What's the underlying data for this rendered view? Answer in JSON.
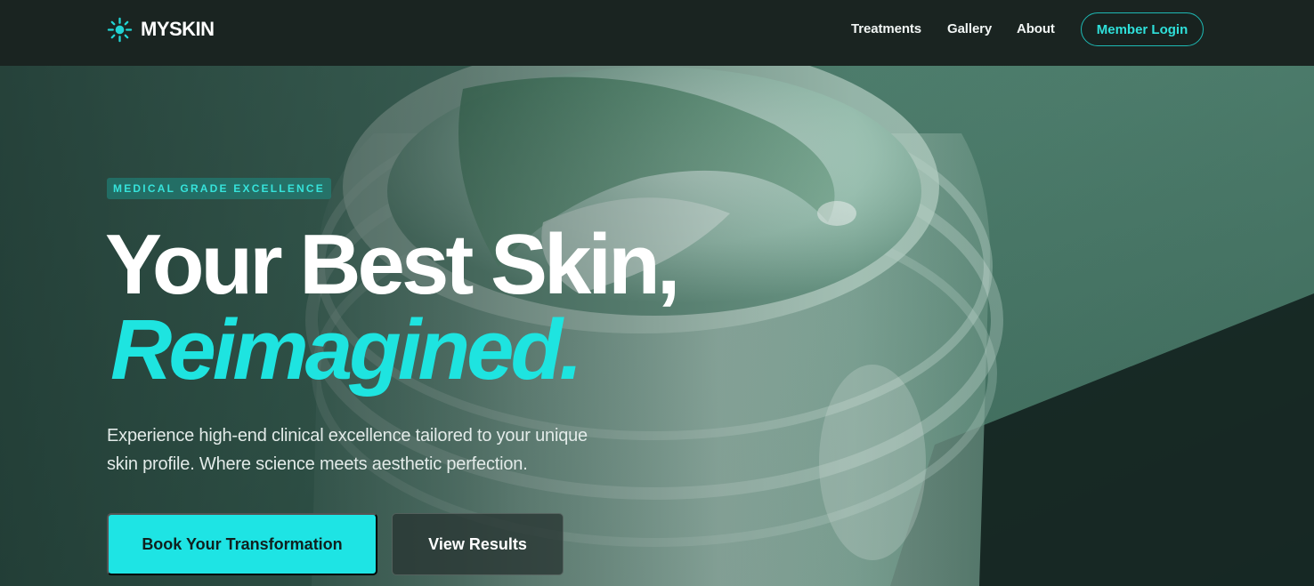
{
  "header": {
    "logo_text": "MYSKIN",
    "logo_icon": "sparkle-sun-icon",
    "nav": [
      {
        "label": "Treatments"
      },
      {
        "label": "Gallery"
      },
      {
        "label": "About"
      }
    ],
    "login_label": "Member Login"
  },
  "hero": {
    "badge": "MEDICAL GRADE EXCELLENCE",
    "title_line1": "Your Best Skin,",
    "title_line2": "Reimagined.",
    "subtitle_line1": "Experience high-end clinical excellence tailored to your unique",
    "subtitle_line2": "skin profile. Where science meets aesthetic perfection.",
    "primary_cta": "Book Your Transformation",
    "secondary_cta": "View Results"
  },
  "colors": {
    "accent": "#1ee4e4",
    "header_bg": "#1a2421",
    "hero_bg": "#4e7c6d"
  }
}
